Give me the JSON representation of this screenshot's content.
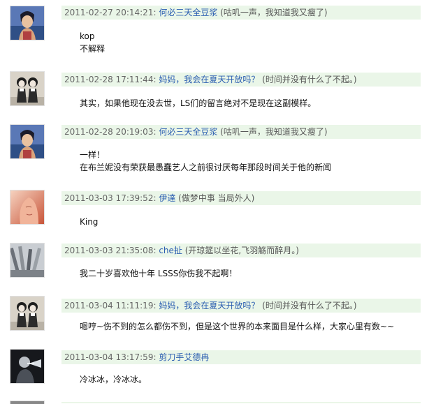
{
  "comments": [
    {
      "avatar_icon": "anime-man-avatar",
      "time": "2011-02-27 20:14:21:",
      "author": "何必三天全豆浆",
      "signature": "(咕叽一声，我知道我又瘦了)",
      "lines": [
        "kop",
        "不解释"
      ]
    },
    {
      "avatar_icon": "twin-girls-avatar",
      "time": "2011-02-28 17:11:44:",
      "author": "妈妈，我会在夏天开放吗？",
      "signature": "(时间并没有什么了不起。)",
      "lines": [
        "其实，如果他现在没去世，LS们的留言绝对不是现在这副模样。"
      ]
    },
    {
      "avatar_icon": "anime-man-avatar",
      "time": "2011-02-28 20:19:03:",
      "author": "何必三天全豆浆",
      "signature": "(咕叽一声，我知道我又瘦了)",
      "lines": [
        "一样！",
        "在布兰妮没有荣获最愚蠢艺人之前很讨厌每年那段时间关于他的新闻"
      ]
    },
    {
      "avatar_icon": "buddha-face-avatar",
      "time": "2011-03-03 17:39:52:",
      "author": "伊達",
      "signature": "(做梦中事 当局外人)",
      "lines": [
        "King"
      ]
    },
    {
      "avatar_icon": "pipes-avatar",
      "time": "2011-03-03 21:35:08:",
      "author": "che扯",
      "signature": "(开琼筵以坐花,飞羽觞而醉月。)",
      "lines": [
        "我二十岁喜欢他十年 LSSS你伤我不起啊！"
      ]
    },
    {
      "avatar_icon": "twin-girls-avatar",
      "time": "2011-03-04 11:11:19:",
      "author": "妈妈，我会在夏天开放吗？",
      "signature": "(时间并没有什么了不起。)",
      "lines": [
        "嗯哼~伤不到的怎么都伤不到，但是这个世界的本来面目是什么样，大家心里有数~~"
      ]
    },
    {
      "avatar_icon": "trumpet-player-avatar",
      "time": "2011-03-04 13:17:59:",
      "author": "剪刀手艾德冉",
      "signature": "",
      "lines": [
        "冷冰冰，冷冰冰。"
      ]
    }
  ]
}
